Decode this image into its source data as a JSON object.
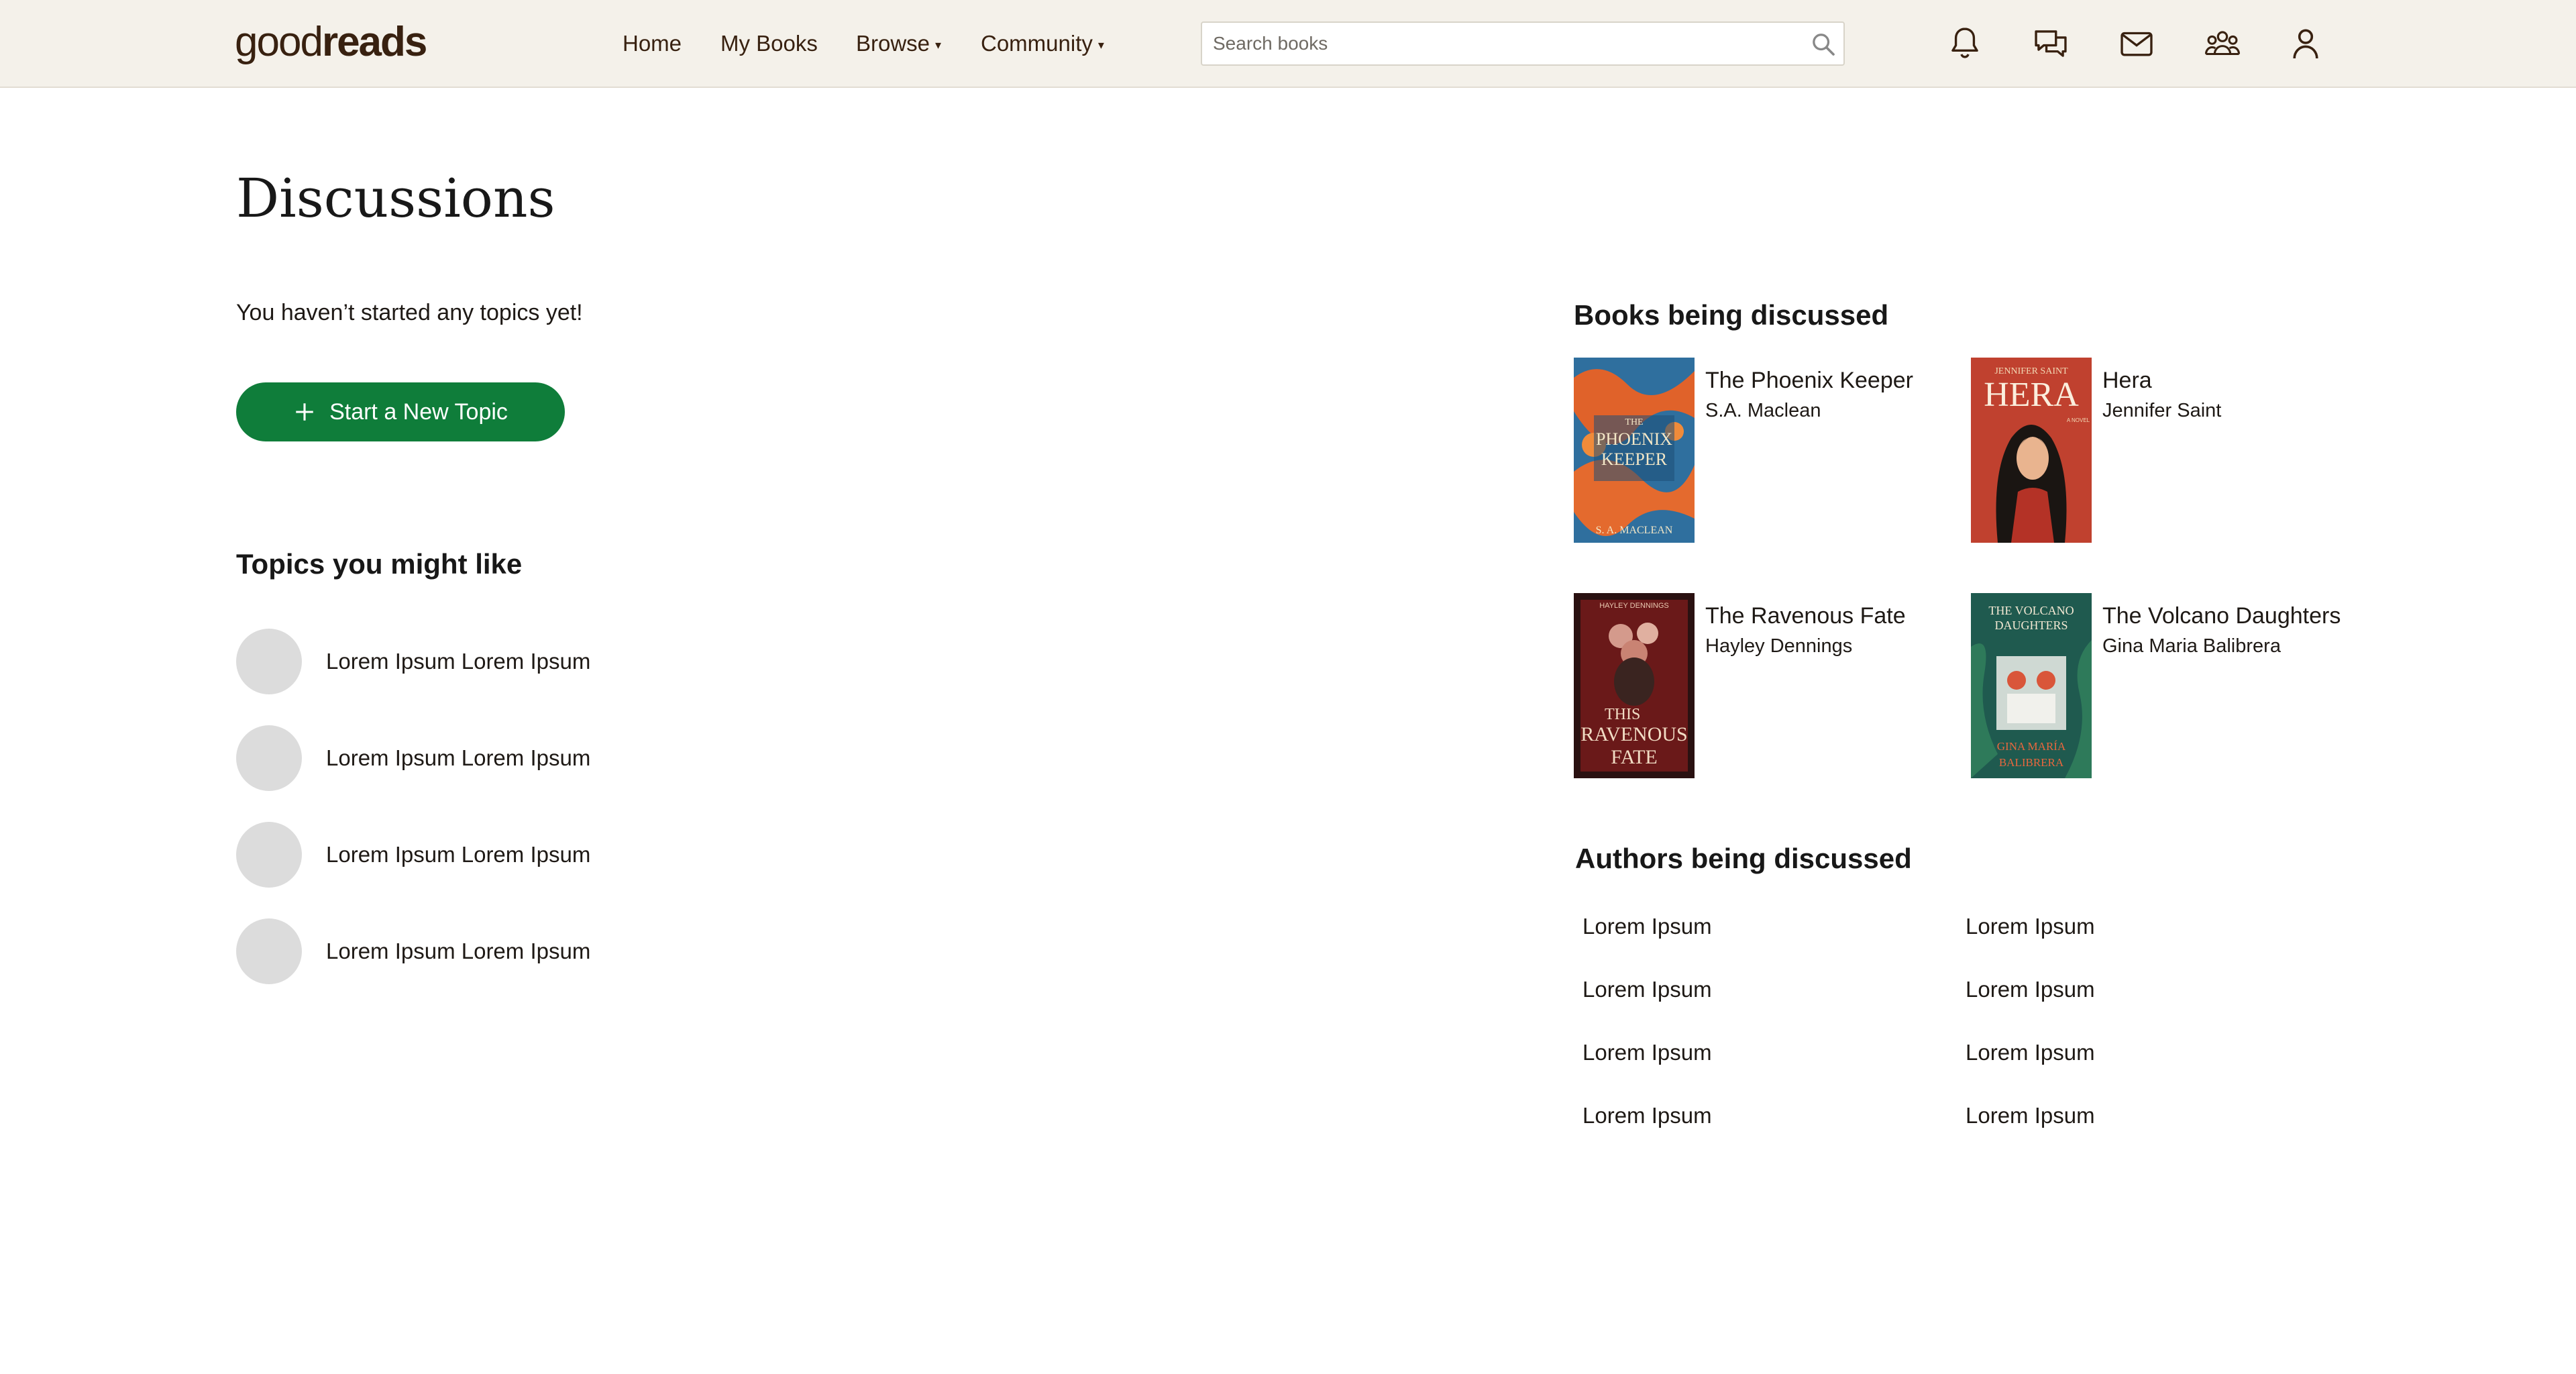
{
  "header": {
    "logo_light": "good",
    "logo_bold": "reads",
    "nav": {
      "home": "Home",
      "my_books": "My Books",
      "browse": "Browse",
      "community": "Community",
      "dropdown_caret": "▾"
    },
    "search": {
      "placeholder": "Search books",
      "value": ""
    },
    "icons": [
      "bell-icon",
      "chat-icon",
      "mail-icon",
      "friends-icon",
      "profile-icon"
    ]
  },
  "main": {
    "title": "Discussions",
    "empty_message": "You haven’t started any topics yet!",
    "new_topic_button": "Start a New Topic",
    "topics_heading": "Topics you might like",
    "topics": [
      {
        "label": "Lorem Ipsum Lorem Ipsum"
      },
      {
        "label": "Lorem Ipsum Lorem Ipsum"
      },
      {
        "label": "Lorem Ipsum Lorem Ipsum"
      },
      {
        "label": "Lorem Ipsum Lorem Ipsum"
      }
    ]
  },
  "sidebar": {
    "books_heading": "Books being discussed",
    "books": [
      {
        "title": "The Phoenix Keeper",
        "author": "S.A. Maclean",
        "cover": {
          "line1": "THE",
          "line2": "PHOENIX",
          "line3": "KEEPER",
          "author": "S. A. MACLEAN"
        }
      },
      {
        "title": "Hera",
        "author": "Jennifer Saint",
        "cover": {
          "top": "JENNIFER SAINT",
          "big": "HERA",
          "small": "A NOVEL"
        }
      },
      {
        "title": "The Ravenous Fate",
        "author": "Hayley Dennings",
        "cover": {
          "top": "HAYLEY DENNINGS",
          "line1": "THIS",
          "line2": "RAVENOUS",
          "line3": "FATE"
        }
      },
      {
        "title": "The Volcano Daughters",
        "author": "Gina Maria Balibrera",
        "cover": {
          "line1": "THE VOLCANO",
          "line2": "DAUGHTERS",
          "author1": "GINA MARÍA",
          "author2": "BALIBRERA"
        }
      }
    ],
    "authors_heading": "Authors being discussed",
    "authors": [
      "Lorem Ipsum",
      "Lorem Ipsum",
      "Lorem Ipsum",
      "Lorem Ipsum",
      "Lorem Ipsum",
      "Lorem Ipsum",
      "Lorem Ipsum",
      "Lorem Ipsum"
    ]
  },
  "colors": {
    "header_bg": "#f4f1ea",
    "brand_brown": "#382110",
    "primary_button": "#0f7d3a",
    "avatar_placeholder": "#dcdcdc"
  }
}
